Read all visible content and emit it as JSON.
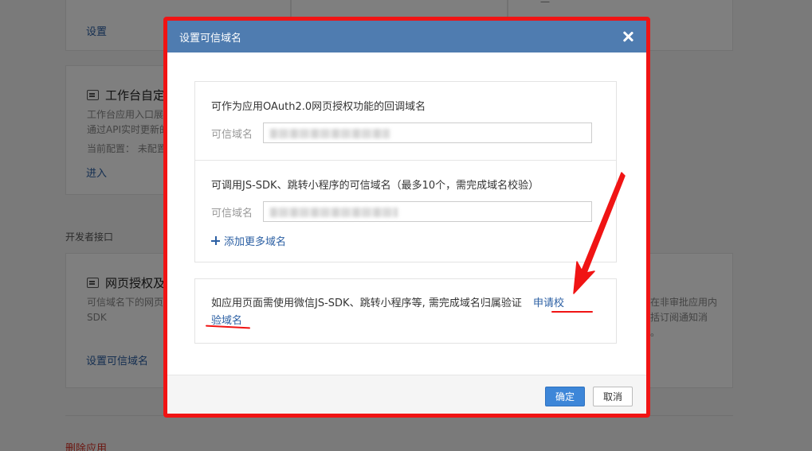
{
  "background": {
    "card1_link": "设置",
    "card2_title": "工作台自定",
    "card2_desc_line1": "工作台应用入口展",
    "card2_desc_line2": "通过API实时更新的",
    "card2_config": "当前配置：  未配置",
    "card2_link": "进入",
    "section_label": "开发者接口",
    "card3_title": "网页授权及",
    "card3_desc_line1": "可信域名下的网页",
    "card3_desc_line2": "SDK",
    "card3_link": "设置可信域名",
    "right_text_line1": "在非审批应用内",
    "right_text_line2": "括订阅通知消",
    "right_text_line3": "。",
    "right_top_text": "一",
    "danger": "删除应用"
  },
  "dialog": {
    "title": "设置可信域名",
    "oauth_title": "可作为应用OAuth2.0网页授权功能的回调域名",
    "oauth_label": "可信域名",
    "jssdk_title": "可调用JS-SDK、跳转小程序的可信域名（最多10个，需完成域名校验）",
    "jssdk_label": "可信域名",
    "add_more": "添加更多域名",
    "notice_text": "如应用页面需使用微信JS-SDK、跳转小程序等, 需完成域名归属验证",
    "notice_link_part1": "申请校",
    "notice_link_part2": "验域名",
    "ok_button": "确定",
    "cancel_button": "取消"
  },
  "colors": {
    "header_blue": "#4f7cb0",
    "annotation_red": "#f01414",
    "link_blue": "#2b5fa3",
    "primary_button": "#3d86d8"
  },
  "icons": [
    "close-icon",
    "plus-icon",
    "arrow-annotation",
    "card-icon"
  ]
}
